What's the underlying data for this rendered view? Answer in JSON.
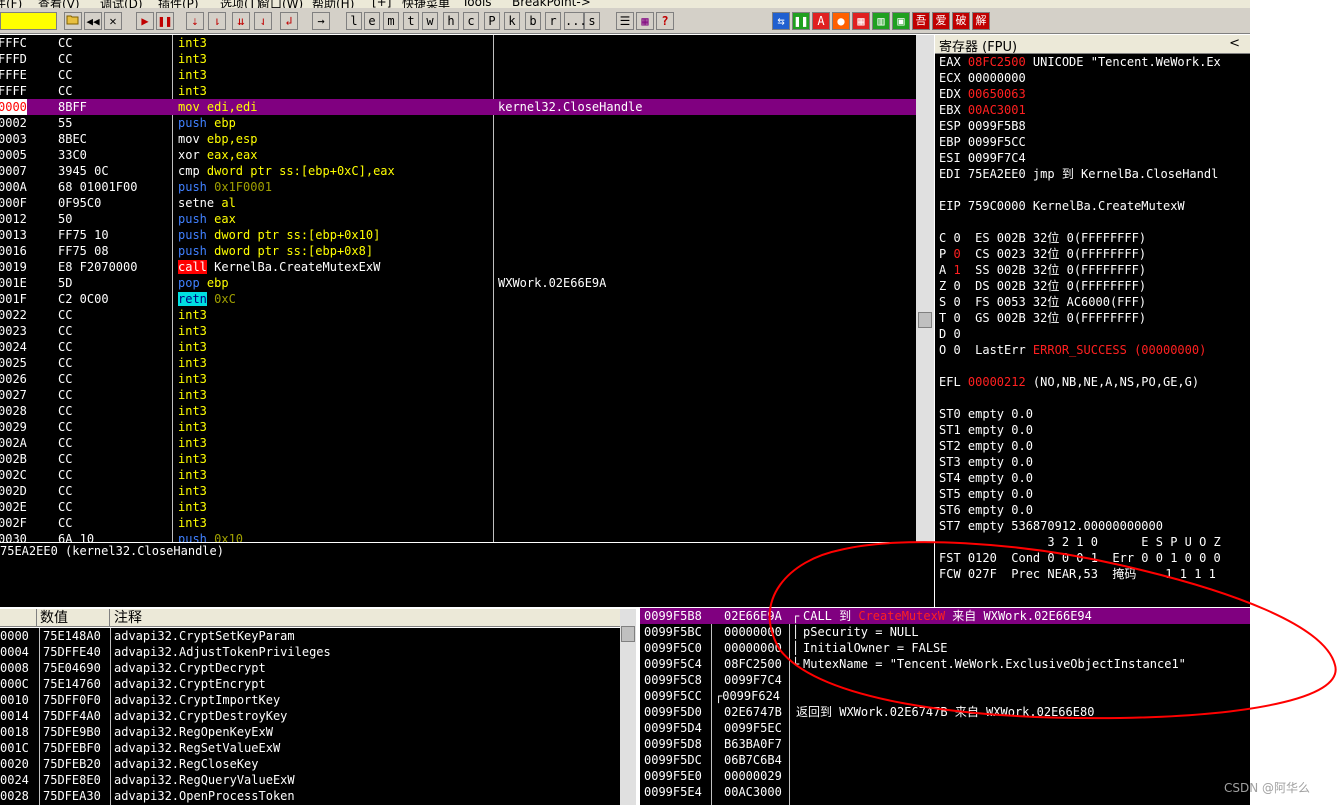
{
  "menu": [
    "件(F)",
    "查看(V)",
    "调试(D)",
    "插件(P)",
    "选项(T)",
    "窗口(W)",
    "帮助(H)",
    "[+]",
    "快捷菜单",
    "Tools",
    "BreakPoint->"
  ],
  "toolbar": {
    "letters": [
      "l",
      "e",
      "m",
      "t",
      "w",
      "h",
      "c",
      "P",
      "k",
      "b",
      "r",
      "...",
      "s"
    ],
    "icons": [
      "open",
      "rewind",
      "close",
      "run",
      "pause",
      "step-into",
      "step-over",
      "trace-into",
      "trace-over",
      "execute-till-return",
      "goto"
    ],
    "right_icons": [
      "refresh",
      "pause",
      "A",
      "record",
      "grid",
      "grid2",
      "吾",
      "爱",
      "破",
      "解"
    ]
  },
  "disasm": {
    "rows": [
      {
        "addr": "FFFC",
        "hex": "CC",
        "instr": [
          {
            "t": "int3",
            "c": "yellow"
          }
        ],
        "comment": ""
      },
      {
        "addr": "FFFD",
        "hex": "CC",
        "instr": [
          {
            "t": "int3",
            "c": "yellow"
          }
        ],
        "comment": ""
      },
      {
        "addr": "FFFE",
        "hex": "CC",
        "instr": [
          {
            "t": "int3",
            "c": "yellow"
          }
        ],
        "comment": ""
      },
      {
        "addr": "FFFF",
        "hex": "CC",
        "instr": [
          {
            "t": "int3",
            "c": "yellow"
          }
        ],
        "comment": ""
      },
      {
        "addr": "0000",
        "hex": "8BFF",
        "instr": [
          {
            "t": "mov ",
            "c": "yellow"
          },
          {
            "t": "edi,edi",
            "c": "yellow"
          }
        ],
        "comment": "kernel32.CloseHandle",
        "highlight": true
      },
      {
        "addr": "0002",
        "hex": "55",
        "instr": [
          {
            "t": "push ",
            "c": "blue"
          },
          {
            "t": "ebp",
            "c": "yellow"
          }
        ],
        "comment": ""
      },
      {
        "addr": "0003",
        "hex": "8BEC",
        "instr": [
          {
            "t": "mov ",
            "c": "white"
          },
          {
            "t": "ebp,esp",
            "c": "yellow"
          }
        ],
        "comment": ""
      },
      {
        "addr": "0005",
        "hex": "33C0",
        "instr": [
          {
            "t": "xor ",
            "c": "white"
          },
          {
            "t": "eax,eax",
            "c": "yellow"
          }
        ],
        "comment": ""
      },
      {
        "addr": "0007",
        "hex": "3945 0C",
        "instr": [
          {
            "t": "cmp ",
            "c": "white"
          },
          {
            "t": "dword ptr ss:[ebp+0xC],eax",
            "c": "yellow"
          }
        ],
        "comment": ""
      },
      {
        "addr": "000A",
        "hex": "68 01001F00",
        "instr": [
          {
            "t": "push ",
            "c": "blue"
          },
          {
            "t": "0x1F0001",
            "c": "olive"
          }
        ],
        "comment": ""
      },
      {
        "addr": "000F",
        "hex": "0F95C0",
        "instr": [
          {
            "t": "setne ",
            "c": "white"
          },
          {
            "t": "al",
            "c": "yellow"
          }
        ],
        "comment": ""
      },
      {
        "addr": "0012",
        "hex": "50",
        "instr": [
          {
            "t": "push ",
            "c": "blue"
          },
          {
            "t": "eax",
            "c": "yellow"
          }
        ],
        "comment": ""
      },
      {
        "addr": "0013",
        "hex": "FF75 10",
        "instr": [
          {
            "t": "push ",
            "c": "blue"
          },
          {
            "t": "dword ptr ss:[ebp+0x10]",
            "c": "yellow"
          }
        ],
        "comment": ""
      },
      {
        "addr": "0016",
        "hex": "FF75 08",
        "instr": [
          {
            "t": "push ",
            "c": "blue"
          },
          {
            "t": "dword ptr ss:[ebp+0x8]",
            "c": "yellow"
          }
        ],
        "comment": ""
      },
      {
        "addr": "0019",
        "hex": "E8 F2070000",
        "instr": [
          {
            "t": "call",
            "c": "callbg"
          },
          {
            "t": " KernelBa.CreateMutexExW",
            "c": "white"
          }
        ],
        "comment": ""
      },
      {
        "addr": "001E",
        "hex": "5D",
        "instr": [
          {
            "t": "pop ",
            "c": "blue"
          },
          {
            "t": "ebp",
            "c": "yellow"
          }
        ],
        "comment": "WXWork.02E66E9A"
      },
      {
        "addr": "001F",
        "hex": "C2 0C00",
        "instr": [
          {
            "t": "retn",
            "c": "retnbg"
          },
          {
            "t": " 0xC",
            "c": "olive"
          }
        ],
        "comment": ""
      },
      {
        "addr": "0022",
        "hex": "CC",
        "instr": [
          {
            "t": "int3",
            "c": "yellow"
          }
        ],
        "comment": ""
      },
      {
        "addr": "0023",
        "hex": "CC",
        "instr": [
          {
            "t": "int3",
            "c": "yellow"
          }
        ],
        "comment": ""
      },
      {
        "addr": "0024",
        "hex": "CC",
        "instr": [
          {
            "t": "int3",
            "c": "yellow"
          }
        ],
        "comment": ""
      },
      {
        "addr": "0025",
        "hex": "CC",
        "instr": [
          {
            "t": "int3",
            "c": "yellow"
          }
        ],
        "comment": ""
      },
      {
        "addr": "0026",
        "hex": "CC",
        "instr": [
          {
            "t": "int3",
            "c": "yellow"
          }
        ],
        "comment": ""
      },
      {
        "addr": "0027",
        "hex": "CC",
        "instr": [
          {
            "t": "int3",
            "c": "yellow"
          }
        ],
        "comment": ""
      },
      {
        "addr": "0028",
        "hex": "CC",
        "instr": [
          {
            "t": "int3",
            "c": "yellow"
          }
        ],
        "comment": ""
      },
      {
        "addr": "0029",
        "hex": "CC",
        "instr": [
          {
            "t": "int3",
            "c": "yellow"
          }
        ],
        "comment": ""
      },
      {
        "addr": "002A",
        "hex": "CC",
        "instr": [
          {
            "t": "int3",
            "c": "yellow"
          }
        ],
        "comment": ""
      },
      {
        "addr": "002B",
        "hex": "CC",
        "instr": [
          {
            "t": "int3",
            "c": "yellow"
          }
        ],
        "comment": ""
      },
      {
        "addr": "002C",
        "hex": "CC",
        "instr": [
          {
            "t": "int3",
            "c": "yellow"
          }
        ],
        "comment": ""
      },
      {
        "addr": "002D",
        "hex": "CC",
        "instr": [
          {
            "t": "int3",
            "c": "yellow"
          }
        ],
        "comment": ""
      },
      {
        "addr": "002E",
        "hex": "CC",
        "instr": [
          {
            "t": "int3",
            "c": "yellow"
          }
        ],
        "comment": ""
      },
      {
        "addr": "002F",
        "hex": "CC",
        "instr": [
          {
            "t": "int3",
            "c": "yellow"
          }
        ],
        "comment": ""
      },
      {
        "addr": "0030",
        "hex": "6A 10",
        "instr": [
          {
            "t": "push ",
            "c": "blue"
          },
          {
            "t": "0x10",
            "c": "olive"
          }
        ],
        "comment": ""
      }
    ]
  },
  "info_pane": {
    "text": "75EA2EE0 (kernel32.CloseHandle)"
  },
  "registers": {
    "title": "寄存器 (FPU)",
    "collapse_icon": "<",
    "lines": [
      [
        {
          "t": "EAX ",
          "c": "white"
        },
        {
          "t": "08FC2500",
          "c": "red"
        },
        {
          "t": " UNICODE \"Tencent.WeWork.Ex",
          "c": "white"
        }
      ],
      [
        {
          "t": "ECX 00000000",
          "c": "white"
        }
      ],
      [
        {
          "t": "EDX ",
          "c": "white"
        },
        {
          "t": "00650063",
          "c": "red"
        }
      ],
      [
        {
          "t": "EBX ",
          "c": "white"
        },
        {
          "t": "00AC3001",
          "c": "red"
        }
      ],
      [
        {
          "t": "ESP 0099F5B8",
          "c": "white"
        }
      ],
      [
        {
          "t": "EBP 0099F5CC",
          "c": "white"
        }
      ],
      [
        {
          "t": "ESI 0099F7C4",
          "c": "white"
        }
      ],
      [
        {
          "t": "EDI 75EA2EE0 jmp 到 KernelBa.CloseHandl",
          "c": "white"
        }
      ],
      [],
      [
        {
          "t": "EIP 759C0000 KernelBa.CreateMutexW",
          "c": "white"
        }
      ],
      [],
      [
        {
          "t": "C 0  ES 002B 32位 0(FFFFFFFF)",
          "c": "white"
        }
      ],
      [
        {
          "t": "P ",
          "c": "white"
        },
        {
          "t": "0",
          "c": "red"
        },
        {
          "t": "  CS 0023 32位 0(FFFFFFFF)",
          "c": "white"
        }
      ],
      [
        {
          "t": "A ",
          "c": "white"
        },
        {
          "t": "1",
          "c": "red"
        },
        {
          "t": "  SS 002B 32位 0(FFFFFFFF)",
          "c": "white"
        }
      ],
      [
        {
          "t": "Z 0  DS 002B 32位 0(FFFFFFFF)",
          "c": "white"
        }
      ],
      [
        {
          "t": "S 0  FS 0053 32位 AC6000(FFF)",
          "c": "white"
        }
      ],
      [
        {
          "t": "T 0  GS 002B 32位 0(FFFFFFFF)",
          "c": "white"
        }
      ],
      [
        {
          "t": "D 0",
          "c": "white"
        }
      ],
      [
        {
          "t": "O 0  LastErr ",
          "c": "white"
        },
        {
          "t": "ERROR_SUCCESS (00000000)",
          "c": "red"
        }
      ],
      [],
      [
        {
          "t": "EFL ",
          "c": "white"
        },
        {
          "t": "00000212",
          "c": "red"
        },
        {
          "t": " (NO,NB,NE,A,NS,PO,GE,G)",
          "c": "white"
        }
      ],
      [],
      [
        {
          "t": "ST0 empty 0.0",
          "c": "white"
        }
      ],
      [
        {
          "t": "ST1 empty 0.0",
          "c": "white"
        }
      ],
      [
        {
          "t": "ST2 empty 0.0",
          "c": "white"
        }
      ],
      [
        {
          "t": "ST3 empty 0.0",
          "c": "white"
        }
      ],
      [
        {
          "t": "ST4 empty 0.0",
          "c": "white"
        }
      ],
      [
        {
          "t": "ST5 empty 0.0",
          "c": "white"
        }
      ],
      [
        {
          "t": "ST6 empty 0.0",
          "c": "white"
        }
      ],
      [
        {
          "t": "ST7 empty 536870912.00000000000",
          "c": "white"
        }
      ],
      [
        {
          "t": "               3 2 1 0      E S P U O Z",
          "c": "white"
        }
      ],
      [
        {
          "t": "FST 0120  Cond 0 0 0 1  Err 0 0 1 0 0 0",
          "c": "white"
        }
      ],
      [
        {
          "t": "FCW 027F  Prec NEAR,53  掩码    1 1 1 1",
          "c": "white"
        }
      ]
    ]
  },
  "dump": {
    "headers": [
      "数值",
      "注释"
    ],
    "rows": [
      {
        "addr": "0000",
        "val": "75E148A0",
        "comment": "advapi32.CryptSetKeyParam"
      },
      {
        "addr": "0004",
        "val": "75DFFE40",
        "comment": "advapi32.AdjustTokenPrivileges"
      },
      {
        "addr": "0008",
        "val": "75E04690",
        "comment": "advapi32.CryptDecrypt"
      },
      {
        "addr": "000C",
        "val": "75E14760",
        "comment": "advapi32.CryptEncrypt"
      },
      {
        "addr": "0010",
        "val": "75DFF0F0",
        "comment": "advapi32.CryptImportKey"
      },
      {
        "addr": "0014",
        "val": "75DFF4A0",
        "comment": "advapi32.CryptDestroyKey"
      },
      {
        "addr": "0018",
        "val": "75DFE9B0",
        "comment": "advapi32.RegOpenKeyExW"
      },
      {
        "addr": "001C",
        "val": "75DFEBF0",
        "comment": "advapi32.RegSetValueExW"
      },
      {
        "addr": "0020",
        "val": "75DFEB20",
        "comment": "advapi32.RegCloseKey"
      },
      {
        "addr": "0024",
        "val": "75DFE8E0",
        "comment": "advapi32.RegQueryValueExW"
      },
      {
        "addr": "0028",
        "val": "75DFEA30",
        "comment": "advapi32.OpenProcessToken"
      }
    ]
  },
  "stack": {
    "rows": [
      {
        "addr": "0099F5B8",
        "val": "02E66E9A",
        "comment": [
          {
            "t": "CALL 到 ",
            "c": "white"
          },
          {
            "t": "CreateMutexW",
            "c": "red"
          },
          {
            "t": " 来自 WXWork.02E66E94",
            "c": "white"
          }
        ],
        "highlight": true,
        "bracket": "┌"
      },
      {
        "addr": "0099F5BC",
        "val": "00000000",
        "comment": [
          {
            "t": "pSecurity = NULL",
            "c": "white"
          }
        ],
        "bracket": "│"
      },
      {
        "addr": "0099F5C0",
        "val": "00000000",
        "comment": [
          {
            "t": "InitialOwner = FALSE",
            "c": "white"
          }
        ],
        "bracket": "│"
      },
      {
        "addr": "0099F5C4",
        "val": "08FC2500",
        "comment": [
          {
            "t": "MutexName = \"Tencent.WeWork.ExclusiveObjectInstance1\"",
            "c": "white"
          }
        ],
        "bracket": "└"
      },
      {
        "addr": "0099F5C8",
        "val": "0099F7C4",
        "comment": [],
        "bracket": ""
      },
      {
        "addr": "0099F5CC",
        "val": "┌0099F624",
        "comment": [],
        "bracket": ""
      },
      {
        "addr": "0099F5D0",
        "val": "02E6747B",
        "comment": [
          {
            "t": "返回到 WXWork.02E6747B 来自 WXWork.02E66E80",
            "c": "white"
          }
        ],
        "bracket": ""
      },
      {
        "addr": "0099F5D4",
        "val": "0099F5EC",
        "comment": [],
        "bracket": ""
      },
      {
        "addr": "0099F5D8",
        "val": "B63BA0F7",
        "comment": [],
        "bracket": ""
      },
      {
        "addr": "0099F5DC",
        "val": "06B7C6B4",
        "comment": [],
        "bracket": ""
      },
      {
        "addr": "0099F5E0",
        "val": "00000029",
        "comment": [],
        "bracket": ""
      },
      {
        "addr": "0099F5E4",
        "val": "00AC3000",
        "comment": [],
        "bracket": ""
      }
    ]
  },
  "watermark": "CSDN @阿华么",
  "colors": {
    "annotation_circle": "#ff0000",
    "highlight_row": "#800080"
  }
}
